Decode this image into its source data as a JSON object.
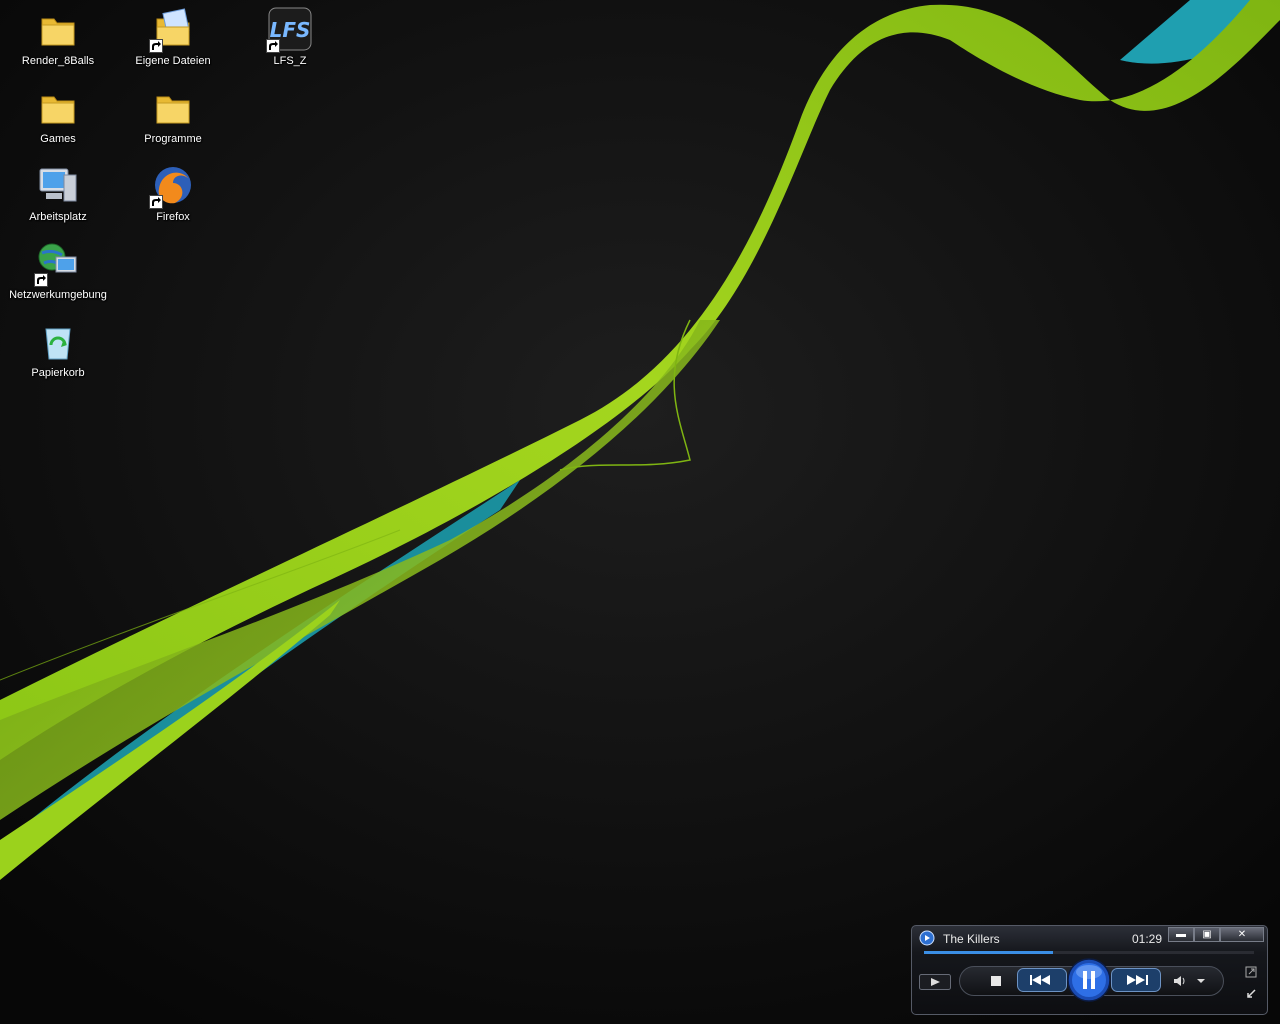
{
  "desktop": {
    "icons": [
      {
        "label": "Render_8Balls",
        "icon": "folder-icon",
        "shortcut": false
      },
      {
        "label": "Eigene Dateien",
        "icon": "my-documents-folder-icon",
        "shortcut": true
      },
      {
        "label": "LFS_Z",
        "icon": "lfs-app-icon",
        "shortcut": true
      },
      {
        "label": "Games",
        "icon": "folder-icon",
        "shortcut": false
      },
      {
        "label": "Programme",
        "icon": "folder-icon",
        "shortcut": false
      },
      {
        "label": "Arbeitsplatz",
        "icon": "my-computer-icon",
        "shortcut": false
      },
      {
        "label": "Firefox",
        "icon": "firefox-icon",
        "shortcut": true
      },
      {
        "label": "Netzwerkumgebung",
        "icon": "network-places-icon",
        "shortcut": true
      },
      {
        "label": "Papierkorb",
        "icon": "recycle-bin-icon",
        "shortcut": false
      }
    ]
  },
  "media_player": {
    "track_title": "The Killers",
    "elapsed_time": "01:29",
    "seek_progress": 0.39,
    "window_buttons": {
      "minimize": "minimize-icon",
      "restore": "restore-icon",
      "close": "close-icon"
    },
    "controls": [
      "now-playing-icon",
      "stop-icon",
      "previous-icon",
      "pause-icon",
      "next-icon",
      "volume-icon",
      "volume-dropdown-icon",
      "switch-to-library-icon",
      "switch-to-skin-icon"
    ],
    "colors": {
      "accent": "#3b8fe6",
      "frame": "#15171c"
    }
  },
  "wallpaper": {
    "colors": {
      "background": "#0b0b0b",
      "ribbon_green": "#9bd21c",
      "ribbon_teal": "#1fa3b0"
    }
  }
}
